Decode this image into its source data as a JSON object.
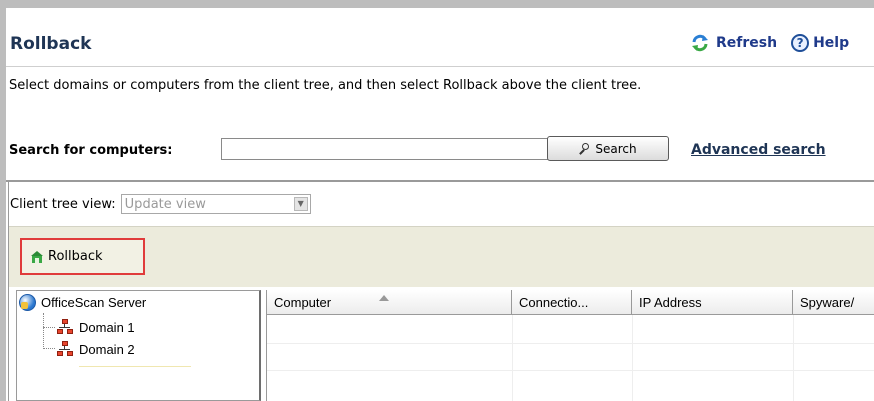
{
  "header": {
    "title": "Rollback",
    "refresh_label": "Refresh",
    "help_label": "Help"
  },
  "description": "Select domains or computers from the client tree, and then select Rollback above the client tree.",
  "search": {
    "label": "Search for computers:",
    "value": "",
    "placeholder": "",
    "button_label": "Search",
    "advanced_label": "Advanced search"
  },
  "client_tree_view": {
    "label": "Client tree view:",
    "selected": "Update view"
  },
  "toolbar": {
    "rollback_label": "Rollback"
  },
  "tree": {
    "root": "OfficeScan Server",
    "nodes": [
      "Domain 1",
      "Domain 2"
    ]
  },
  "grid": {
    "columns": [
      "Computer",
      "Connectio...",
      "IP Address",
      "Spyware/"
    ]
  },
  "colors": {
    "highlight_border": "#e03b3b",
    "toolbar_bg": "#ecebdc",
    "title": "#1f3555",
    "link": "#1f3a8a"
  }
}
